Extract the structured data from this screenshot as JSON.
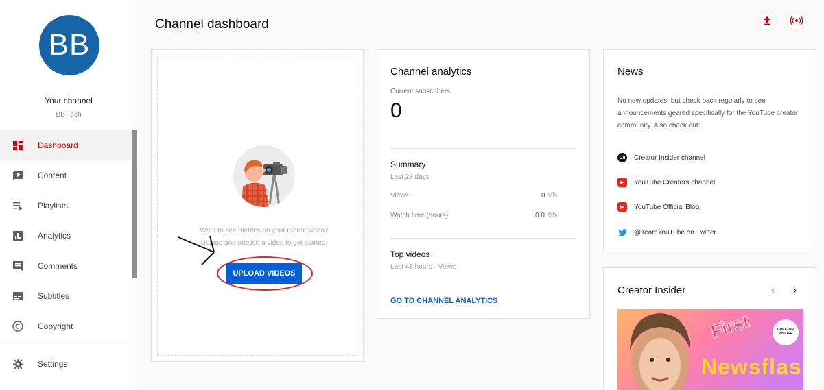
{
  "sidebar": {
    "avatar_initials": "BB",
    "channel_title": "Your channel",
    "channel_name": "BB Tech",
    "items": [
      {
        "label": "Dashboard",
        "icon": "dashboard-icon",
        "active": true
      },
      {
        "label": "Content",
        "icon": "content-icon"
      },
      {
        "label": "Playlists",
        "icon": "playlists-icon"
      },
      {
        "label": "Analytics",
        "icon": "analytics-icon"
      },
      {
        "label": "Comments",
        "icon": "comments-icon"
      },
      {
        "label": "Subtitles",
        "icon": "subtitles-icon"
      },
      {
        "label": "Copyright",
        "icon": "copyright-icon"
      }
    ],
    "bottom_items": [
      {
        "label": "Settings",
        "icon": "gear-icon"
      }
    ]
  },
  "header": {
    "title": "Channel dashboard",
    "upload_icon": "upload-icon",
    "live_icon": "go-live-icon"
  },
  "upload_card": {
    "hint_line1": "Want to see metrics on your recent video?",
    "hint_line2": "Upload and publish a video to get started.",
    "button_label": "UPLOAD VIDEOS"
  },
  "analytics_card": {
    "title": "Channel analytics",
    "subscribers_label": "Current subscribers",
    "subscribers_value": "0",
    "summary_title": "Summary",
    "summary_period": "Last 28 days",
    "rows": [
      {
        "label": "Views",
        "value": "0",
        "pct": "0%"
      },
      {
        "label": "Watch time (hours)",
        "value": "0.0",
        "pct": "0%"
      }
    ],
    "top_videos_title": "Top videos",
    "top_videos_period": "Last 48 hours · Views",
    "link_label": "GO TO CHANNEL ANALYTICS"
  },
  "news_card": {
    "title": "News",
    "description": "No new updates, but check back regularly to see announcements geared specifically for the YouTube creator community. Also check out:",
    "links": [
      {
        "label": "Creator Insider channel",
        "icon": "creator-insider-icon",
        "icon_text": "C/I"
      },
      {
        "label": "YouTube Creators channel",
        "icon": "youtube-icon"
      },
      {
        "label": "YouTube Official Blog",
        "icon": "youtube-icon"
      },
      {
        "label": "@TeamYouTube on Twitter",
        "icon": "twitter-icon"
      }
    ]
  },
  "creator_insider_card": {
    "title": "Creator Insider",
    "thumb_badge": "CREATOR INSIDER",
    "thumb_text_1": "First",
    "thumb_text_2": "Newsflash"
  },
  "colors": {
    "accent_red": "#cc0000",
    "link_blue": "#065fd4",
    "avatar_blue": "#1565a8"
  }
}
